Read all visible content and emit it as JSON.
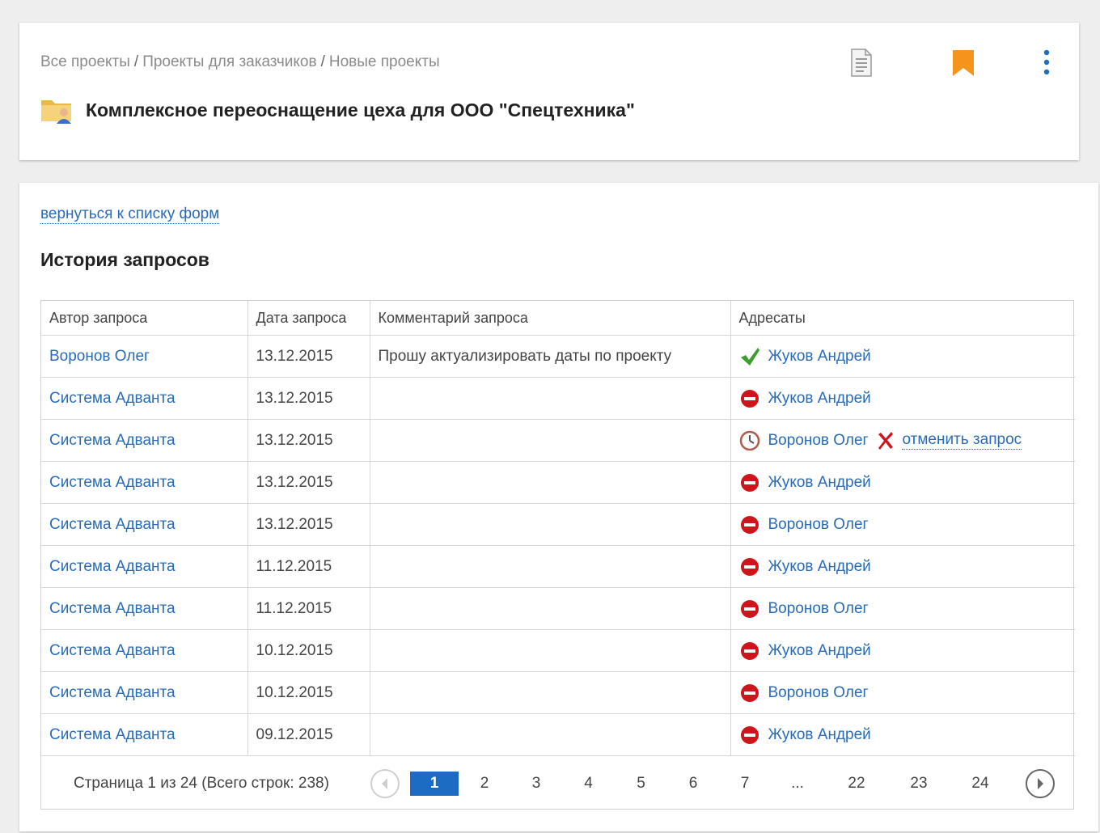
{
  "header": {
    "breadcrumb": [
      "Все проекты",
      "Проекты для заказчиков",
      "Новые проекты"
    ],
    "separator": "/",
    "title": "Комплексное переоснащение цеха для ООО \"Спецтехника\"",
    "icons": {
      "folder": "folder-user-icon",
      "document": "document-icon",
      "bookmark": "bookmark-icon",
      "more": "more-vertical-icon"
    },
    "bookmark_color": "#f5941d"
  },
  "main": {
    "back_link": "вернуться к списку форм",
    "section_title": "История запросов",
    "columns": [
      "Автор запроса",
      "Дата запроса",
      "Комментарий запроса",
      "Адресаты"
    ],
    "rows": [
      {
        "author": "Воронов Олег",
        "date": "13.12.2015",
        "comment": "Прошу актуализировать даты по проекту",
        "status": "approved",
        "recipient": "Жуков Андрей"
      },
      {
        "author": "Система Адванта",
        "date": "13.12.2015",
        "comment": "",
        "status": "declined",
        "recipient": "Жуков Андрей"
      },
      {
        "author": "Система Адванта",
        "date": "13.12.2015",
        "comment": "",
        "status": "pending",
        "recipient": "Воронов Олег",
        "action": "отменить запрос"
      },
      {
        "author": "Система Адванта",
        "date": "13.12.2015",
        "comment": "",
        "status": "declined",
        "recipient": "Жуков Андрей"
      },
      {
        "author": "Система Адванта",
        "date": "13.12.2015",
        "comment": "",
        "status": "declined",
        "recipient": "Воронов Олег"
      },
      {
        "author": "Система Адванта",
        "date": "11.12.2015",
        "comment": "",
        "status": "declined",
        "recipient": "Жуков Андрей"
      },
      {
        "author": "Система Адванта",
        "date": "11.12.2015",
        "comment": "",
        "status": "declined",
        "recipient": "Воронов Олег"
      },
      {
        "author": "Система Адванта",
        "date": "10.12.2015",
        "comment": "",
        "status": "declined",
        "recipient": "Жуков Андрей"
      },
      {
        "author": "Система Адванта",
        "date": "10.12.2015",
        "comment": "",
        "status": "declined",
        "recipient": "Воронов Олег"
      },
      {
        "author": "Система Адванта",
        "date": "09.12.2015",
        "comment": "",
        "status": "declined",
        "recipient": "Жуков Андрей"
      }
    ],
    "pager": {
      "info": "Страница 1 из 24 (Всего строк: 238)",
      "current": "1",
      "pages": [
        "1",
        "2",
        "3",
        "4",
        "5",
        "6",
        "7",
        "...",
        "22",
        "23",
        "24"
      ]
    }
  },
  "colors": {
    "link": "#2a6bb8",
    "active_page": "#1c6cc3",
    "approved": "#3aa02b",
    "declined": "#d0141b",
    "cancel": "#d0141b"
  }
}
